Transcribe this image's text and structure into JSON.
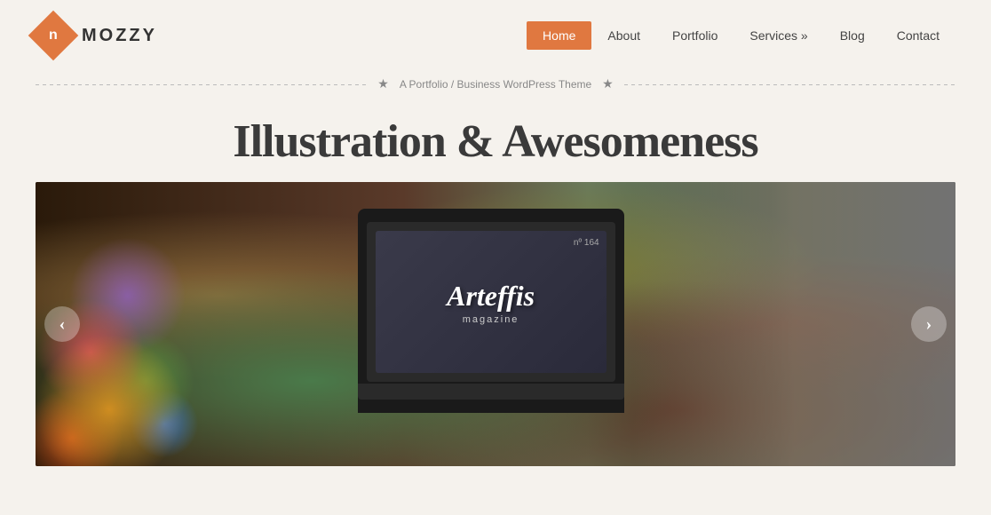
{
  "header": {
    "logo_letter": "n",
    "logo_text": "MOZZY"
  },
  "nav": {
    "items": [
      {
        "label": "Home",
        "active": true
      },
      {
        "label": "About",
        "active": false
      },
      {
        "label": "Portfolio",
        "active": false
      },
      {
        "label": "Services »",
        "active": false
      },
      {
        "label": "Blog",
        "active": false
      },
      {
        "label": "Contact",
        "active": false
      }
    ]
  },
  "divider": {
    "text": "A Portfolio / Business WordPress Theme"
  },
  "hero": {
    "title": "Illustration & Awesomeness"
  },
  "slide": {
    "magazine_number": "nº 164",
    "magazine_title": "Arteffis",
    "magazine_subtitle": "magazine"
  },
  "arrows": {
    "left": "‹",
    "right": "›"
  }
}
